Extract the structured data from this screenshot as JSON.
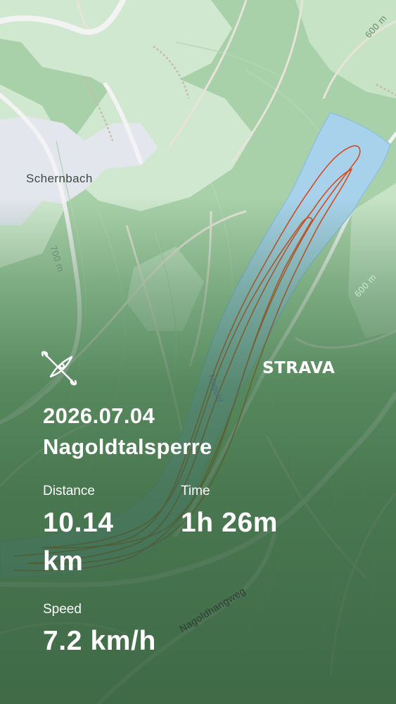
{
  "map": {
    "place_label": "Schernbach",
    "contours": [
      "600 m",
      "700 m",
      "600 m"
    ],
    "water_label": "Nagold",
    "road_label": "Nagoldhangweg"
  },
  "activity": {
    "icon": "kayak-icon",
    "brand": "STRAVA",
    "date": "2026.07.04",
    "location": "Nagoldtalsperre",
    "distance_label": "Distance",
    "distance_value": "10.14",
    "distance_unit": "km",
    "time_label": "Time",
    "time_value": "1h 26m",
    "speed_label": "Speed",
    "speed_value": "7.2 km/h"
  },
  "colors": {
    "forest": "#a9d1a9",
    "meadow": "#cfe8cf",
    "village": "#e4e6ee",
    "water": "#a8d2ec",
    "route": "#d44b1e",
    "road": "#f3f3f3"
  }
}
